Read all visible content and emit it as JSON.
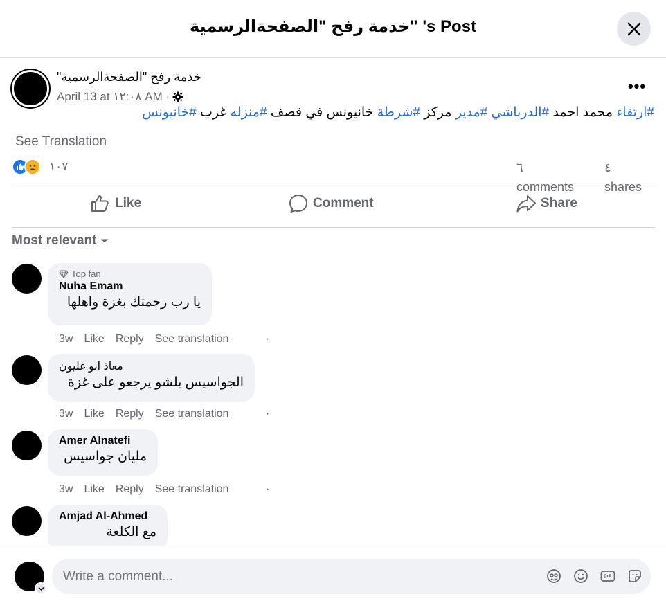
{
  "header": {
    "title": "خدمة رفح \"الصفحةالرسمية\" 's Post",
    "close_icon": "close-icon"
  },
  "post": {
    "author": "\"خدمة رفح \"الصفحةالرسمية",
    "timestamp": "April 13 at ١٢:٠٨ AM ·",
    "privacy_icon": "gear-icon",
    "more_label": "•••",
    "text_segments": [
      {
        "text": "#ارتقاء",
        "tag": true
      },
      {
        "text": " محمد احمد ",
        "tag": false
      },
      {
        "text": "#الدرباشي",
        "tag": true
      },
      {
        "text": " ",
        "tag": false
      },
      {
        "text": "#مدير",
        "tag": true
      },
      {
        "text": " مركز ",
        "tag": false
      },
      {
        "text": "#شرطة",
        "tag": true
      },
      {
        "text": " خانيونس في قصف ",
        "tag": false
      },
      {
        "text": "#منزله",
        "tag": true
      },
      {
        "text": " غرب ",
        "tag": false
      },
      {
        "text": "#خانيونس",
        "tag": true
      }
    ],
    "see_translation": "See Translation",
    "reaction_count": "١٠٧",
    "comments_count": "٦",
    "comments_label": "comments",
    "shares_count": "٤",
    "shares_label": "shares"
  },
  "actions": {
    "like": "Like",
    "comment": "Comment",
    "share": "Share"
  },
  "sort_label": "Most relevant",
  "comments": [
    {
      "badge": "Top fan",
      "name": "Nuha Emam",
      "text": "يا رب رحمتك بغزة واهلها",
      "time": "3w",
      "like": "Like",
      "reply": "Reply",
      "translate": "See translation",
      "dot": "·"
    },
    {
      "badge": "",
      "name": "معاذ ابو غليون",
      "text": "الجواسيس بلشو يرجعو على غزة",
      "time": "3w",
      "like": "Like",
      "reply": "Reply",
      "translate": "See translation",
      "dot": "·"
    },
    {
      "badge": "",
      "name": "Amer Alnatefi",
      "text": "مليان جواسيس",
      "time": "3w",
      "like": "Like",
      "reply": "Reply",
      "translate": "See translation",
      "dot": "·"
    },
    {
      "badge": "",
      "name": "Amjad Al-Ahmed",
      "text": "مع الكلعة"
    }
  ],
  "composer": {
    "placeholder": "Write a comment...",
    "icons": [
      "avatar-sticker-icon",
      "emoji-icon",
      "gif-icon",
      "sticker-icon"
    ]
  },
  "colors": {
    "hashtag": "#216fdb",
    "like_blue": "#1877f2",
    "secondary_text": "#65676b",
    "bubble_bg": "#f0f2f5"
  }
}
